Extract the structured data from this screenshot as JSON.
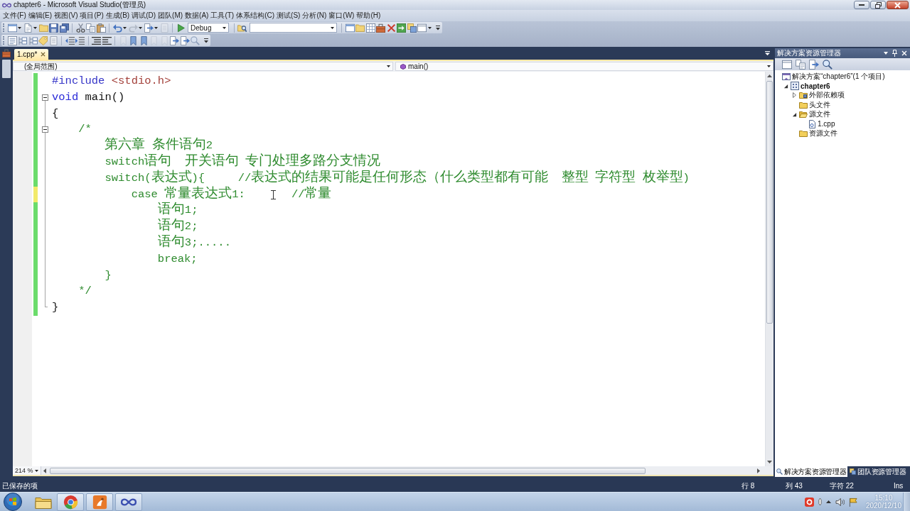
{
  "window": {
    "title": "chapter6 - Microsoft Visual Studio(管理员)"
  },
  "menu": [
    "文件(F)",
    "编辑(E)",
    "视图(V)",
    "项目(P)",
    "生成(B)",
    "调试(D)",
    "团队(M)",
    "数据(A)",
    "工具(T)",
    "体系结构(C)",
    "测试(S)",
    "分析(N)",
    "窗口(W)",
    "帮助(H)"
  ],
  "toolbar": {
    "configuration": "Debug"
  },
  "editor_tabs": [
    {
      "label": "1.cpp*",
      "selected": true
    }
  ],
  "navigation_bar": {
    "scope": "(全局范围)",
    "member": "main()"
  },
  "code_lines": [
    {
      "unsaved": false,
      "fold": false,
      "tokens": [
        {
          "kind": "preprocessor",
          "text": "#include"
        },
        {
          "kind": "header",
          "text": " <stdio.h>"
        }
      ]
    },
    {
      "unsaved": false,
      "fold": true,
      "tokens": [
        {
          "kind": "keyword",
          "text": "void"
        },
        {
          "kind": "plain",
          "text": " main()"
        }
      ]
    },
    {
      "unsaved": false,
      "fold": false,
      "tokens": [
        {
          "kind": "plain",
          "text": "{"
        }
      ]
    },
    {
      "unsaved": false,
      "fold": true,
      "tokens": [
        {
          "kind": "comment",
          "text": "    /*"
        }
      ]
    },
    {
      "unsaved": false,
      "fold": false,
      "tokens": [
        {
          "kind": "comment",
          "text": "        第六章 条件语句2"
        }
      ]
    },
    {
      "unsaved": false,
      "fold": false,
      "tokens": [
        {
          "kind": "comment",
          "text": "        switch语句  开关语句 专门处理多路分支情况"
        }
      ]
    },
    {
      "unsaved": false,
      "fold": false,
      "tokens": [
        {
          "kind": "comment",
          "text": "        switch(表达式){     //表达式的结果可能是任何形态（什么类型都有可能  整型 字符型 枚举型)"
        }
      ]
    },
    {
      "unsaved": true,
      "fold": false,
      "tokens": [
        {
          "kind": "comment",
          "text": "            case 常量表达式1:"
        },
        {
          "kind": "comment",
          "text": "       //常量"
        }
      ]
    },
    {
      "unsaved": false,
      "fold": false,
      "tokens": [
        {
          "kind": "comment",
          "text": "                语句1;"
        }
      ]
    },
    {
      "unsaved": false,
      "fold": false,
      "tokens": [
        {
          "kind": "comment",
          "text": "                语句2;"
        }
      ]
    },
    {
      "unsaved": false,
      "fold": false,
      "tokens": [
        {
          "kind": "comment",
          "text": "                语句3;....."
        }
      ]
    },
    {
      "unsaved": false,
      "fold": false,
      "tokens": [
        {
          "kind": "comment",
          "text": "                break;"
        }
      ]
    },
    {
      "unsaved": false,
      "fold": false,
      "tokens": [
        {
          "kind": "comment",
          "text": "        }"
        }
      ]
    },
    {
      "unsaved": false,
      "fold": false,
      "tokens": [
        {
          "kind": "comment",
          "text": "    */"
        }
      ]
    },
    {
      "unsaved": false,
      "fold": false,
      "tokens": [
        {
          "kind": "plain",
          "text": "}"
        }
      ]
    }
  ],
  "zoom": "214 %",
  "solution_explorer": {
    "title": "解决方案资源管理器",
    "tree": [
      {
        "kind": "solution",
        "label": "解决方案“chapter6”(1 个项目)",
        "children": [
          {
            "kind": "project",
            "label": "chapter6",
            "expanded": true,
            "children": [
              {
                "kind": "references",
                "label": "外部依赖项",
                "expanded": false
              },
              {
                "kind": "folder",
                "label": "头文件"
              },
              {
                "kind": "folder",
                "label": "源文件",
                "expanded": true,
                "children": [
                  {
                    "kind": "file",
                    "label": "1.cpp"
                  }
                ]
              },
              {
                "kind": "folder",
                "label": "资源文件"
              }
            ]
          }
        ]
      }
    ],
    "tabs": [
      {
        "label": "解决方案资源管理器",
        "selected": true
      },
      {
        "label": "团队资源管理器",
        "selected": false
      }
    ]
  },
  "status_bar": {
    "message": "已保存的项",
    "line": "行 8",
    "column": "列 43",
    "character": "字符 22",
    "mode": "Ins"
  },
  "taskbar": {
    "apps": [
      {
        "kind": "folder",
        "running": false
      },
      {
        "kind": "round-logo",
        "running": true
      },
      {
        "kind": "tile",
        "running": true
      },
      {
        "kind": "infinity",
        "running": true
      }
    ],
    "clock": {
      "time": "15:10",
      "date": "2020/12/10"
    }
  }
}
